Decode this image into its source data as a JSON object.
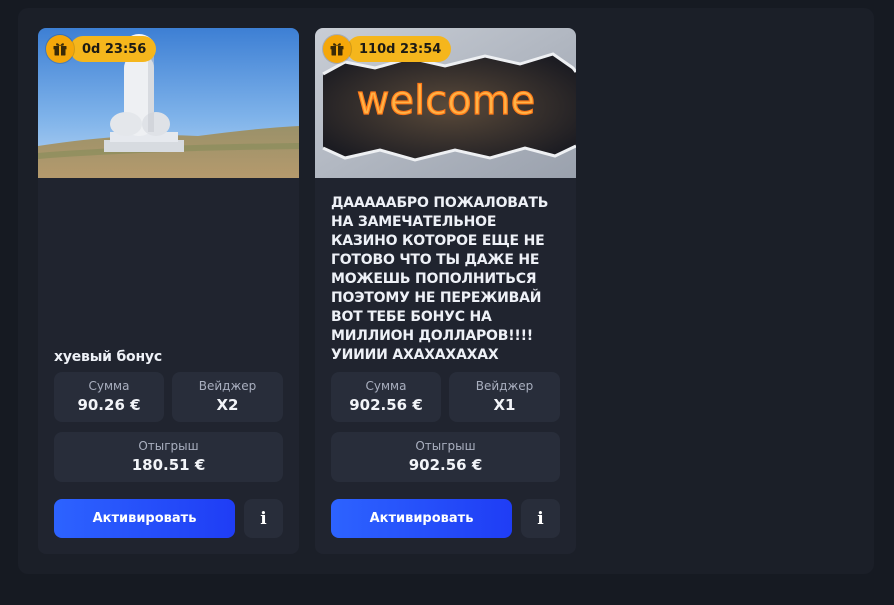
{
  "bonuses": [
    {
      "timer": "0d 23:56",
      "title": "хуевый бонус",
      "sum_label": "Сумма",
      "sum_value": "90.26 €",
      "wager_label": "Вейджер",
      "wager_value": "X2",
      "wager_win_label": "Отыгрыш",
      "wager_win_value": "180.51 €",
      "activate_label": "Активировать",
      "info_icon": "i"
    },
    {
      "timer": "110d 23:54",
      "banner_text": "welcome",
      "title": "ДАААААБРО ПОЖАЛОВАТЬ НА ЗАМЕЧАТЕЛЬНОЕ КАЗИНО КОТОРОЕ ЕЩЕ НЕ ГОТОВО ЧТО ТЫ ДАЖЕ НЕ МОЖЕШЬ ПОПОЛНИТЬСЯ ПОЭТОМУ НЕ ПЕРЕЖИВАЙ ВОТ ТЕБЕ БОНУС НА МИЛЛИОН ДОЛЛАРОВ!!!! УИИИИ АХАХАХАХАХ",
      "sum_label": "Сумма",
      "sum_value": "902.56 €",
      "wager_label": "Вейджер",
      "wager_value": "X1",
      "wager_win_label": "Отыгрыш",
      "wager_win_value": "902.56 €",
      "activate_label": "Активировать",
      "info_icon": "i"
    }
  ],
  "colors": {
    "page_bg": "#161a22",
    "panel_bg": "#1b1f28",
    "card_bg": "#20242f",
    "stat_bg": "#282d3a",
    "timer_bg": "#f5b61c",
    "accent_blue": "#2450ff"
  },
  "icons": {
    "timer_icon": "gift-icon",
    "info_icon": "info-icon"
  }
}
